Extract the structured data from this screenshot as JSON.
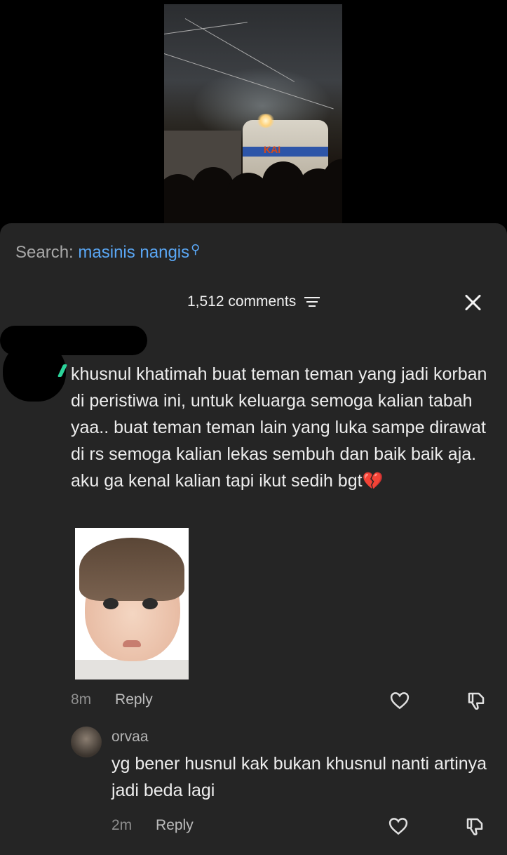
{
  "video": {
    "locomotive_text": "KAI"
  },
  "search": {
    "label": "Search:",
    "query": "masinis nangis"
  },
  "comments_header": {
    "count_text": "1,512 comments"
  },
  "comment": {
    "text": "khusnul khatimah buat teman teman yang jadi korban di peristiwa ini, untuk keluarga semoga kalian tabah yaa.. buat teman teman lain yang luka sampe dirawat di rs semoga kalian lekas sembuh dan baik baik aja. aku ga kenal kalian tapi ikut sedih bgt",
    "emoji": "💔",
    "time": "8m",
    "reply_label": "Reply"
  },
  "reply": {
    "username": "orvaa",
    "text": "yg bener husnul kak bukan khusnul nanti artinya jadi beda lagi",
    "time": "2m",
    "reply_label": "Reply"
  },
  "colors": {
    "sheet_bg": "#252525",
    "search_accent": "#5aa7f5",
    "verified_tick": "#2bd39a"
  },
  "icons": [
    "search-icon",
    "filter-icon",
    "close-icon",
    "like-heart-icon",
    "dislike-icon"
  ]
}
